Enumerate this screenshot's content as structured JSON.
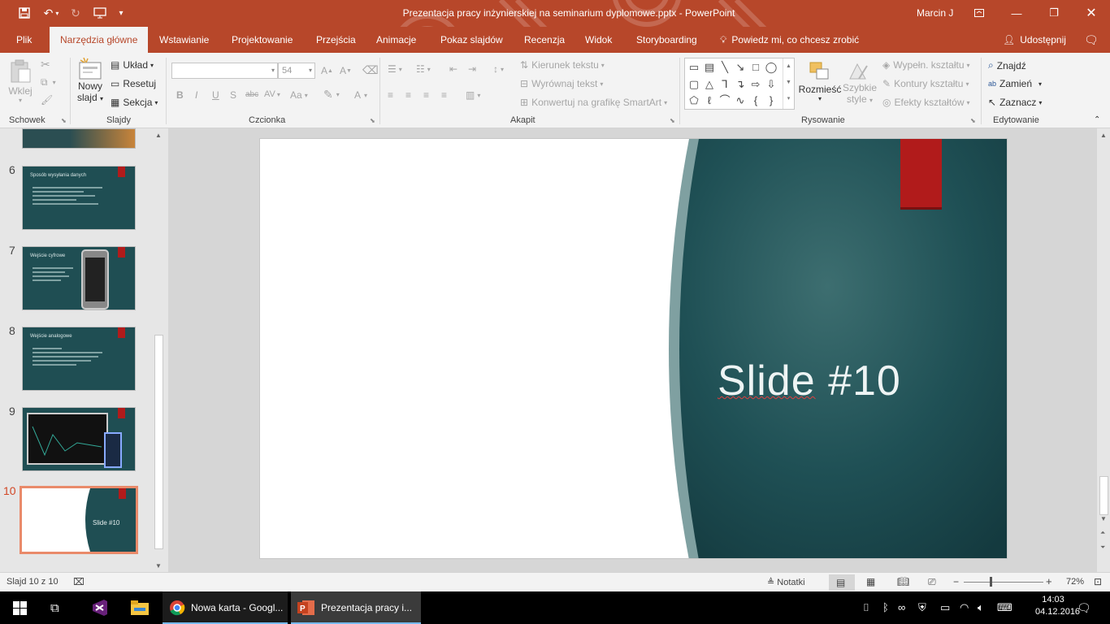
{
  "app": {
    "document_title": "Prezentacja pracy inżynierskiej na seminarium dyplomowe.pptx  -  PowerPoint",
    "user": "Marcin J",
    "share_label": "Udostępnij"
  },
  "tabs": [
    {
      "label": "Plik"
    },
    {
      "label": "Narzędzia główne"
    },
    {
      "label": "Wstawianie"
    },
    {
      "label": "Projektowanie"
    },
    {
      "label": "Przejścia"
    },
    {
      "label": "Animacje"
    },
    {
      "label": "Pokaz slajdów"
    },
    {
      "label": "Recenzja"
    },
    {
      "label": "Widok"
    },
    {
      "label": "Storyboarding"
    }
  ],
  "tell_me": "Powiedz mi, co chcesz zrobić",
  "ribbon": {
    "clipboard": {
      "paste": "Wklej",
      "group": "Schowek"
    },
    "slides": {
      "new_slide_line1": "Nowy",
      "new_slide_line2": "slajd",
      "layout": "Układ",
      "reset": "Resetuj",
      "section": "Sekcja",
      "group": "Slajdy"
    },
    "font": {
      "font_name": "",
      "font_size": "54",
      "group": "Czcionka",
      "bold": "B",
      "italic": "I",
      "underline": "U",
      "shadow": "S",
      "strike": "abc",
      "spacing": "AV",
      "case": "Aa",
      "color": "A"
    },
    "paragraph": {
      "text_direction": "Kierunek tekstu",
      "align_text": "Wyrównaj tekst",
      "smartart": "Konwertuj na grafikę SmartArt",
      "group": "Akapit"
    },
    "drawing": {
      "arrange": "Rozmieść",
      "quick_styles_line1": "Szybkie",
      "quick_styles_line2": "style",
      "fill": "Wypełn. kształtu",
      "outline": "Kontury kształtu",
      "effects": "Efekty kształtów",
      "group": "Rysowanie"
    },
    "editing": {
      "find": "Znajdź",
      "replace": "Zamień",
      "select": "Zaznacz",
      "group": "Edytowanie"
    }
  },
  "thumbnails": [
    {
      "num": "6",
      "title": "Sposób wysyłania danych"
    },
    {
      "num": "7",
      "title": "Wejście cyfrowe"
    },
    {
      "num": "8",
      "title": "Wejście analogowe"
    },
    {
      "num": "9",
      "title": ""
    },
    {
      "num": "10",
      "title": "Slide #10"
    }
  ],
  "slide": {
    "title_word": "Slide",
    "title_rest": " #10"
  },
  "status": {
    "slide_info": "Slajd 10 z 10",
    "notes": "Notatki",
    "zoom": "72%"
  },
  "taskbar": {
    "chrome": "Nowa karta - Googl...",
    "powerpoint": "Prezentacja pracy i...",
    "time": "14:03",
    "date": "04.12.2016"
  },
  "colors": {
    "accent": "#b7472a",
    "slide_bg": "#1f4e53",
    "bookmark": "#b11b1b"
  }
}
